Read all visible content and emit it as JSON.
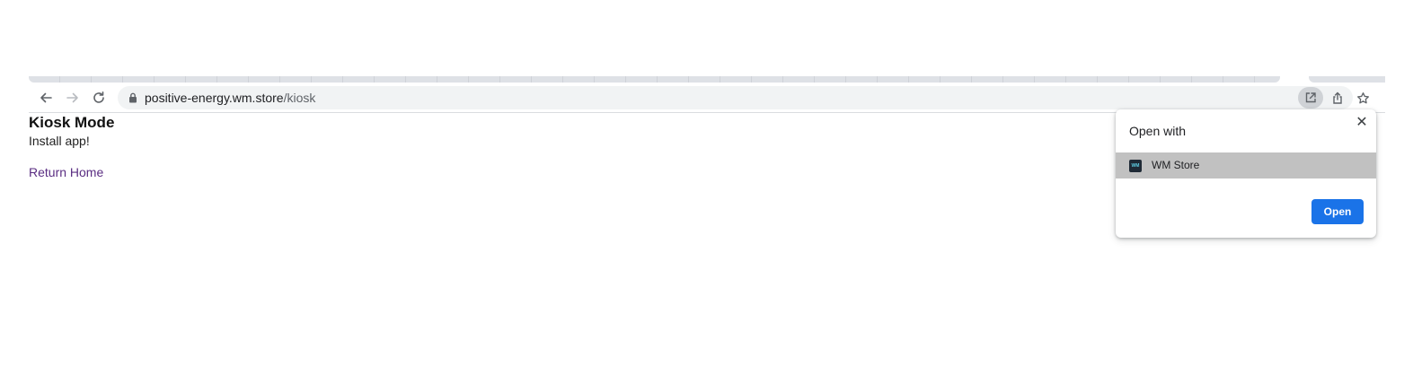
{
  "browser": {
    "url_host": "positive-energy.wm.store",
    "url_path": "/kiosk",
    "icons": {
      "back": "arrow-left-icon",
      "forward": "arrow-right-icon",
      "reload": "reload-icon",
      "lock": "lock-icon",
      "open_in_app": "open-in-app-icon",
      "share": "share-icon",
      "bookmark": "star-icon"
    }
  },
  "page": {
    "title": "Kiosk Mode",
    "subtitle": "Install app!",
    "link": "Return Home"
  },
  "popup": {
    "title": "Open with",
    "app_name": "WM Store",
    "app_icon_text": "WM",
    "open_label": "Open",
    "close_glyph": "✕"
  },
  "colors": {
    "accent": "#1a73e8",
    "link": "#5a2d82",
    "selected_item": "#c1c1c1"
  }
}
